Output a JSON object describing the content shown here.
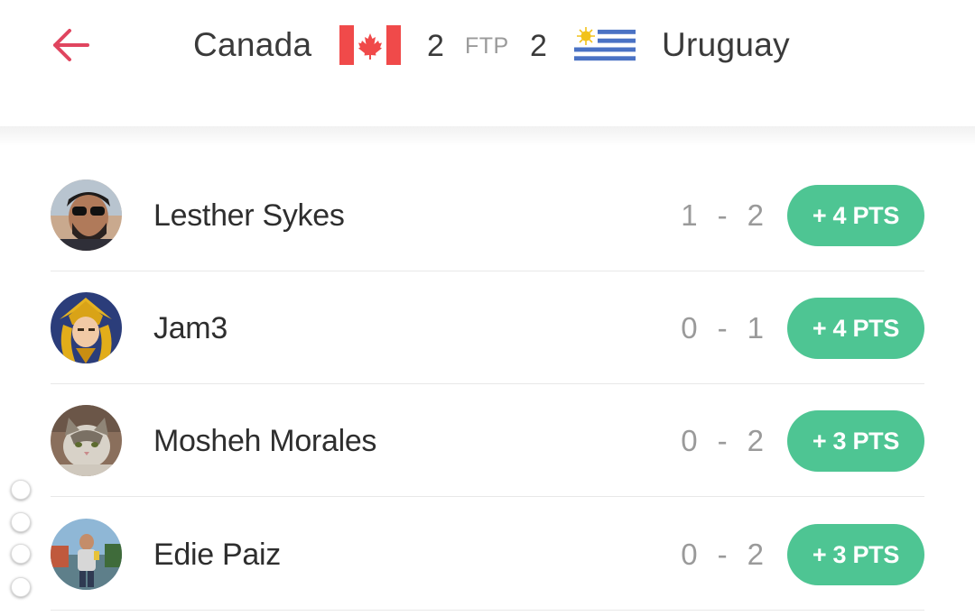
{
  "header": {
    "home_team": "Canada",
    "away_team": "Uruguay",
    "home_score": "2",
    "away_score": "2",
    "status": "FTP",
    "accent_color": "#e0455f"
  },
  "predictions": [
    {
      "name": "Lesther Sykes",
      "home": "1",
      "sep": "-",
      "away": "2",
      "points": "+ 4 PTS"
    },
    {
      "name": "Jam3",
      "home": "0",
      "sep": "-",
      "away": "1",
      "points": "+ 4 PTS"
    },
    {
      "name": "Mosheh Morales",
      "home": "0",
      "sep": "-",
      "away": "2",
      "points": "+ 3 PTS"
    },
    {
      "name": "Edie Paiz",
      "home": "0",
      "sep": "-",
      "away": "2",
      "points": "+ 3 PTS"
    }
  ],
  "colors": {
    "points_badge": "#4ec593",
    "text_primary": "#2e2e2e",
    "text_muted": "#9a9a9a"
  }
}
